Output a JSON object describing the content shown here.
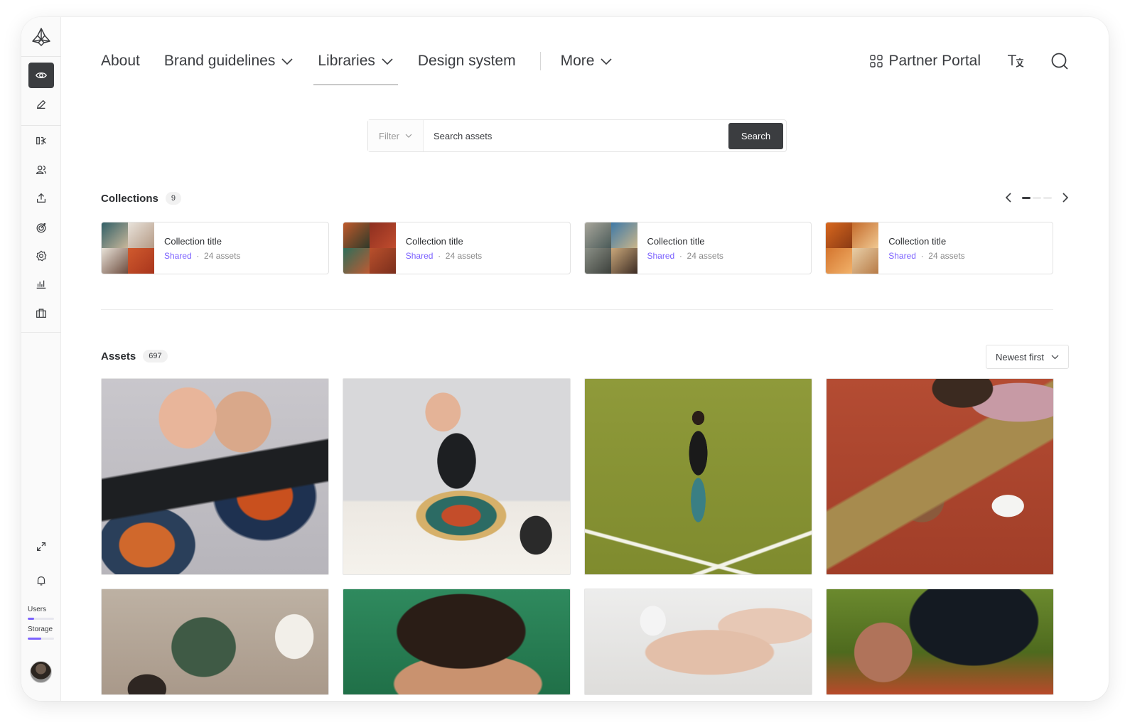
{
  "nav": {
    "items": [
      {
        "label": "About",
        "dropdown": false
      },
      {
        "label": "Brand guidelines",
        "dropdown": true
      },
      {
        "label": "Libraries",
        "dropdown": true,
        "active": true
      },
      {
        "label": "Design system",
        "dropdown": false
      }
    ],
    "more_label": "More",
    "partner_portal_label": "Partner Portal"
  },
  "sidebar": {
    "items": [
      "eye-icon",
      "pencil-icon",
      "content-icon",
      "users-icon",
      "upload-icon",
      "target-icon",
      "settings-icon",
      "analytics-icon",
      "briefcase-icon"
    ],
    "users_label": "Users",
    "users_usage": 0.25,
    "storage_label": "Storage",
    "storage_usage": 0.5
  },
  "search": {
    "filter_label": "Filter",
    "placeholder": "Search assets",
    "button_label": "Search"
  },
  "collections": {
    "title": "Collections",
    "count": "9",
    "carousel_page": 1,
    "carousel_pages": 3,
    "items": [
      {
        "title": "Collection title",
        "shared": "Shared",
        "separator": "·",
        "assets": "24 assets"
      },
      {
        "title": "Collection title",
        "shared": "Shared",
        "separator": "·",
        "assets": "24 assets"
      },
      {
        "title": "Collection title",
        "shared": "Shared",
        "separator": "·",
        "assets": "24 assets"
      },
      {
        "title": "Collection title",
        "shared": "Shared",
        "separator": "·",
        "assets": "24 assets"
      }
    ]
  },
  "assets": {
    "title": "Assets",
    "count": "697",
    "sort_label": "Newest first"
  },
  "colors": {
    "accent": "#7b61ff",
    "dark": "#3b3d40"
  }
}
